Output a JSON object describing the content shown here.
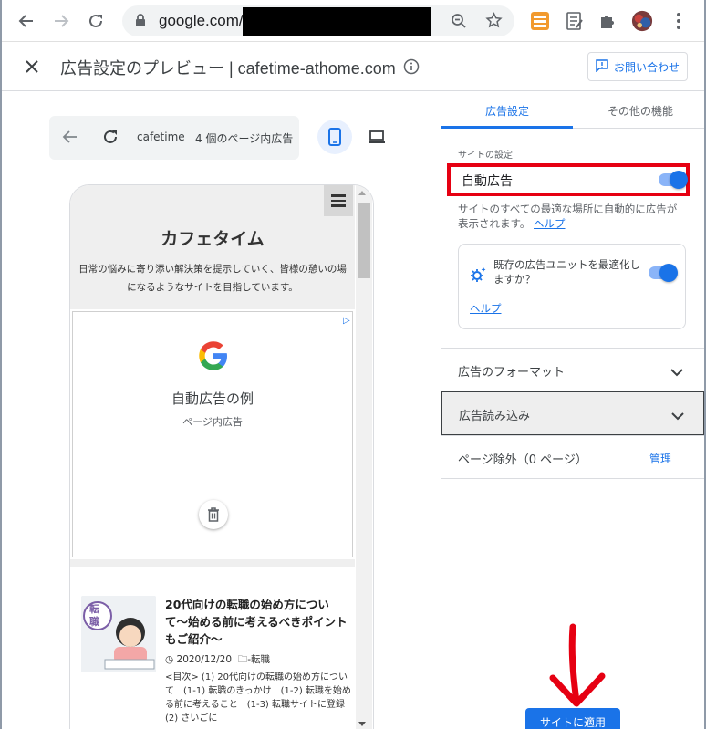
{
  "browser": {
    "url": "google.com/",
    "colors": {
      "accent": "#1a73e8"
    }
  },
  "dialog": {
    "title": "広告設定のプレビュー | cafetime-athome.com",
    "contact_label": "お問い合わせ"
  },
  "preview_toolbar": {
    "site": "cafetime",
    "ad_count": "4 個のページ内広告"
  },
  "site": {
    "title": "カフェタイム",
    "description": "日常の悩みに寄り添い解決策を提示していく、皆様の憩いの場になるようなサイトを目指しています。"
  },
  "ad": {
    "title": "自動広告の例",
    "subtitle": "ページ内広告"
  },
  "article": {
    "title": "20代向けの転職の始め方について〜始める前に考えるべきポイントもご紹介〜",
    "date": "2020/12/20",
    "category": "-転職",
    "body": "<目次> (1) 20代向けの転職の始め方について　(1-1) 転職のきっかけ　(1-2) 転職を始める前に考えること　(1-3) 転職サイトに登録 (2) さいごに",
    "thumb_text": "転職"
  },
  "panel": {
    "tabs": [
      "広告設定",
      "その他の機能"
    ],
    "site_settings_label": "サイトの設定",
    "auto_ads_label": "自動広告",
    "auto_ads_on": true,
    "auto_ads_desc": "サイトのすべての最適な場所に自動的に広告が表示されます。",
    "help_link": "ヘルプ",
    "optimize_text": "既存の広告ユニットを最適化しますか？",
    "optimize_on": true,
    "optimize_help": "ヘルプ",
    "rows": {
      "format": "広告のフォーマット",
      "loading": "広告読み込み",
      "exclusions": "ページ除外（0 ページ）",
      "manage": "管理"
    },
    "apply_label": "サイトに適用"
  }
}
